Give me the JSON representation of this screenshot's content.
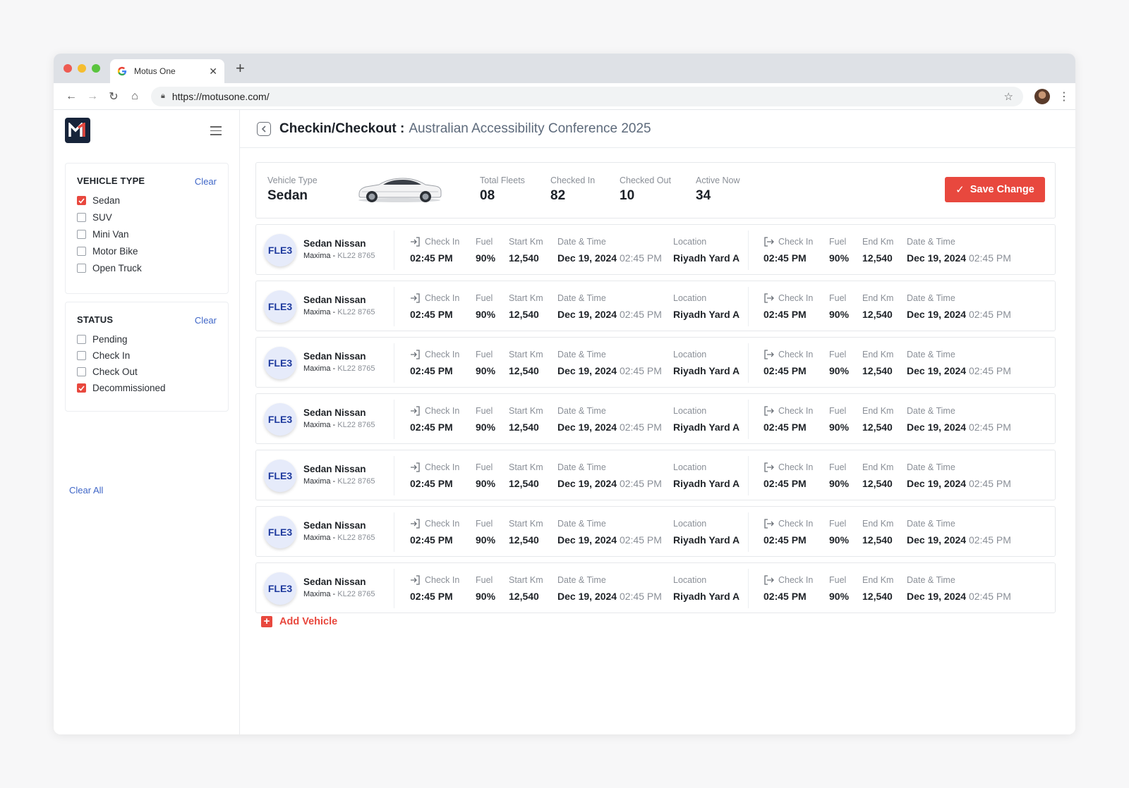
{
  "browser": {
    "tab_title": "Motus One",
    "url": "https://motusone.com/",
    "traffic_colors": [
      "#ee5b52",
      "#f5bd2f",
      "#5ac43e"
    ]
  },
  "sidebar": {
    "vehicle_type": {
      "title": "VEHICLE TYPE",
      "clear_label": "Clear",
      "options": [
        {
          "label": "Sedan",
          "checked": true
        },
        {
          "label": "SUV",
          "checked": false
        },
        {
          "label": "Mini Van",
          "checked": false
        },
        {
          "label": "Motor Bike",
          "checked": false
        },
        {
          "label": "Open Truck",
          "checked": false
        }
      ]
    },
    "status": {
      "title": "STATUS",
      "clear_label": "Clear",
      "options": [
        {
          "label": "Pending",
          "checked": false
        },
        {
          "label": "Check In",
          "checked": false
        },
        {
          "label": "Check Out",
          "checked": false
        },
        {
          "label": "Decommissioned",
          "checked": true
        }
      ]
    },
    "clear_all_label": "Clear All"
  },
  "header": {
    "title": "Checkin/Checkout :",
    "event": "Australian Accessibility Conference 2025"
  },
  "summary": {
    "vehicle_type_label": "Vehicle Type",
    "vehicle_type_value": "Sedan",
    "total_fleets_label": "Total Fleets",
    "total_fleets_value": "08",
    "checked_in_label": "Checked In",
    "checked_in_value": "82",
    "checked_out_label": "Checked Out",
    "checked_out_value": "10",
    "active_now_label": "Active Now",
    "active_now_value": "34",
    "save_label": "Save Change"
  },
  "columns": {
    "check_in": "Check In",
    "fuel": "Fuel",
    "start_km": "Start Km",
    "date_time": "Date & Time",
    "location": "Location",
    "end_km": "End Km"
  },
  "rows": [
    {
      "badge": "FLE3",
      "name": "Sedan Nissan",
      "model": "Maxima - ",
      "plate": "KL22 8765",
      "in_time": "02:45 PM",
      "in_fuel": "90%",
      "start_km": "12,540",
      "in_date": "Dec 19, 2024 ",
      "in_date_time": "02:45 PM",
      "location": "Riyadh Yard A",
      "out_time": "02:45 PM",
      "out_fuel": "90%",
      "end_km": "12,540",
      "out_date": "Dec 19, 2024 ",
      "out_date_time": "02:45 PM"
    },
    {
      "badge": "FLE3",
      "name": "Sedan Nissan",
      "model": "Maxima - ",
      "plate": "KL22 8765",
      "in_time": "02:45 PM",
      "in_fuel": "90%",
      "start_km": "12,540",
      "in_date": "Dec 19, 2024 ",
      "in_date_time": "02:45 PM",
      "location": "Riyadh Yard A",
      "out_time": "02:45 PM",
      "out_fuel": "90%",
      "end_km": "12,540",
      "out_date": "Dec 19, 2024 ",
      "out_date_time": "02:45 PM"
    },
    {
      "badge": "FLE3",
      "name": "Sedan Nissan",
      "model": "Maxima - ",
      "plate": "KL22 8765",
      "in_time": "02:45 PM",
      "in_fuel": "90%",
      "start_km": "12,540",
      "in_date": "Dec 19, 2024 ",
      "in_date_time": "02:45 PM",
      "location": "Riyadh Yard A",
      "out_time": "02:45 PM",
      "out_fuel": "90%",
      "end_km": "12,540",
      "out_date": "Dec 19, 2024 ",
      "out_date_time": "02:45 PM"
    },
    {
      "badge": "FLE3",
      "name": "Sedan Nissan",
      "model": "Maxima - ",
      "plate": "KL22 8765",
      "in_time": "02:45 PM",
      "in_fuel": "90%",
      "start_km": "12,540",
      "in_date": "Dec 19, 2024 ",
      "in_date_time": "02:45 PM",
      "location": "Riyadh Yard A",
      "out_time": "02:45 PM",
      "out_fuel": "90%",
      "end_km": "12,540",
      "out_date": "Dec 19, 2024 ",
      "out_date_time": "02:45 PM"
    },
    {
      "badge": "FLE3",
      "name": "Sedan Nissan",
      "model": "Maxima - ",
      "plate": "KL22 8765",
      "in_time": "02:45 PM",
      "in_fuel": "90%",
      "start_km": "12,540",
      "in_date": "Dec 19, 2024 ",
      "in_date_time": "02:45 PM",
      "location": "Riyadh Yard A",
      "out_time": "02:45 PM",
      "out_fuel": "90%",
      "end_km": "12,540",
      "out_date": "Dec 19, 2024 ",
      "out_date_time": "02:45 PM"
    },
    {
      "badge": "FLE3",
      "name": "Sedan Nissan",
      "model": "Maxima - ",
      "plate": "KL22 8765",
      "in_time": "02:45 PM",
      "in_fuel": "90%",
      "start_km": "12,540",
      "in_date": "Dec 19, 2024 ",
      "in_date_time": "02:45 PM",
      "location": "Riyadh Yard A",
      "out_time": "02:45 PM",
      "out_fuel": "90%",
      "end_km": "12,540",
      "out_date": "Dec 19, 2024 ",
      "out_date_time": "02:45 PM"
    },
    {
      "badge": "FLE3",
      "name": "Sedan Nissan",
      "model": "Maxima - ",
      "plate": "KL22 8765",
      "in_time": "02:45 PM",
      "in_fuel": "90%",
      "start_km": "12,540",
      "in_date": "Dec 19, 2024 ",
      "in_date_time": "02:45 PM",
      "location": "Riyadh Yard A",
      "out_time": "02:45 PM",
      "out_fuel": "90%",
      "end_km": "12,540",
      "out_date": "Dec 19, 2024 ",
      "out_date_time": "02:45 PM"
    }
  ],
  "add_vehicle_label": "Add Vehicle",
  "colors": {
    "accent_red": "#e8483e",
    "link_blue": "#3f66c7",
    "badge_bg": "#e6ebfa",
    "badge_text": "#1e3a9e"
  }
}
